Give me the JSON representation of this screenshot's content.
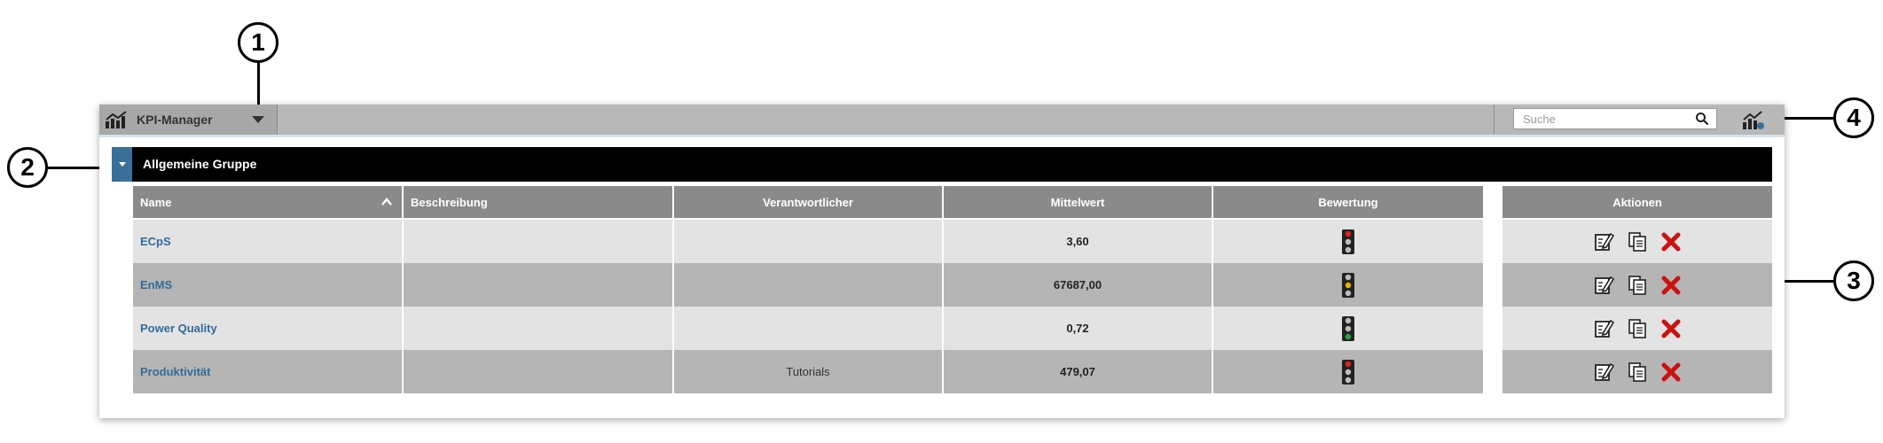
{
  "callouts": [
    "1",
    "2",
    "3",
    "4"
  ],
  "app": {
    "title": "KPI-Manager",
    "logo_icon": "chart-line-icon",
    "menu_icon": "caret-down-icon"
  },
  "search": {
    "placeholder": "Suche",
    "value": ""
  },
  "group": {
    "title": "Allgemeine Gruppe"
  },
  "table": {
    "columns": [
      "Name",
      "Beschreibung",
      "Verantwortlicher",
      "Mittelwert",
      "Bewertung",
      "Aktionen"
    ],
    "rows": [
      {
        "name": "ECpS",
        "beschreibung": "",
        "verantwortlicher": "",
        "mittelwert": "3,60",
        "bewertung": "red"
      },
      {
        "name": "EnMS",
        "beschreibung": "",
        "verantwortlicher": "",
        "mittelwert": "67687,00",
        "bewertung": "yellow"
      },
      {
        "name": "Power Quality",
        "beschreibung": "",
        "verantwortlicher": "",
        "mittelwert": "0,72",
        "bewertung": "green"
      },
      {
        "name": "Produktivität",
        "beschreibung": "",
        "verantwortlicher": "Tutorials",
        "mittelwert": "479,07",
        "bewertung": "red"
      }
    ],
    "action_icons": [
      "edit-icon",
      "copy-icon",
      "delete-icon"
    ]
  },
  "colors": {
    "topbar": "#b8b8b8",
    "group_header": "#000000",
    "toggle": "#3a6f99",
    "link": "#336b9b",
    "delete": "#cc1111",
    "light_red": "#e02020",
    "light_yellow": "#e8b400",
    "light_green": "#2ea043"
  }
}
